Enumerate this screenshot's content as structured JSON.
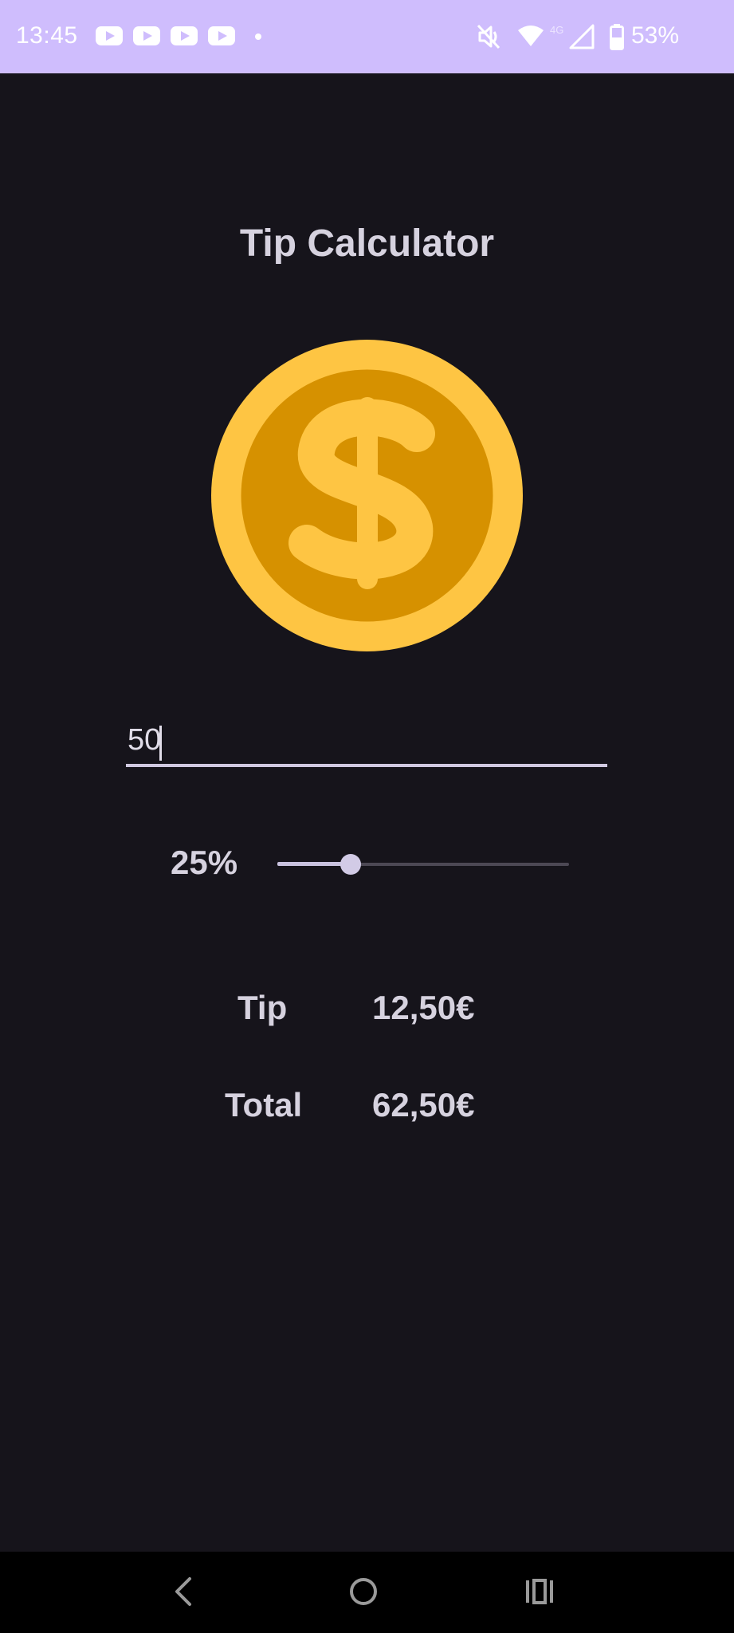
{
  "status_bar": {
    "time": "13:45",
    "notification_icons": [
      "youtube-icon",
      "youtube-icon",
      "youtube-icon",
      "youtube-icon",
      "dot-icon"
    ],
    "right_icons": [
      "mute-icon",
      "wifi-icon",
      "signal-4g-icon",
      "battery-icon"
    ],
    "network_label": "4G",
    "battery": "53%",
    "background_color": "#cfbdfd"
  },
  "app": {
    "title": "Tip Calculator",
    "coin_icon": "dollar-coin-icon",
    "bill_amount": "50",
    "tip_percent_label": "25%",
    "tip_percent_fraction": 0.25,
    "results": {
      "tip_label": "Tip",
      "tip_value": "12,50€",
      "total_label": "Total",
      "total_value": "62,50€"
    }
  },
  "nav_bar": {
    "icons": [
      "back-icon",
      "home-icon",
      "recents-icon"
    ]
  },
  "colors": {
    "background": "#16141b",
    "text": "#d6d2df",
    "accent": "#cfbdfd",
    "coin_outer": "#fec543",
    "coin_inner": "#d69100"
  }
}
